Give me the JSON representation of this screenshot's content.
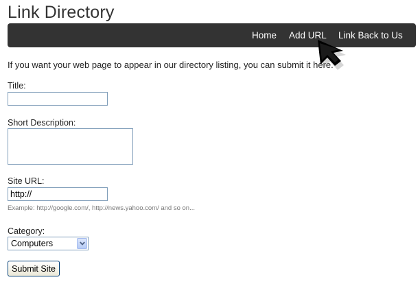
{
  "page": {
    "title": "Link Directory",
    "intro": "If you want your web page to appear in our directory listing, you can submit it here."
  },
  "nav": {
    "items": [
      {
        "label": "Home"
      },
      {
        "label": "Add URL"
      },
      {
        "label": "Link Back to Us"
      }
    ]
  },
  "form": {
    "title_label": "Title:",
    "title_value": "",
    "description_label": "Short Description:",
    "description_value": "",
    "url_label": "Site URL:",
    "url_value": "http://",
    "url_hint": "Example: http://google.com/, http://news.yahoo.com/ and so on...",
    "category_label": "Category:",
    "category_selected": "Computers",
    "submit_label": "Submit Site"
  },
  "colors": {
    "navbar_bg": "#333333",
    "nav_text": "#ffffff",
    "input_border": "#7f9db9"
  },
  "icons": {
    "select_arrow": "chevron-down-icon",
    "pointer": "mouse-cursor-icon"
  }
}
